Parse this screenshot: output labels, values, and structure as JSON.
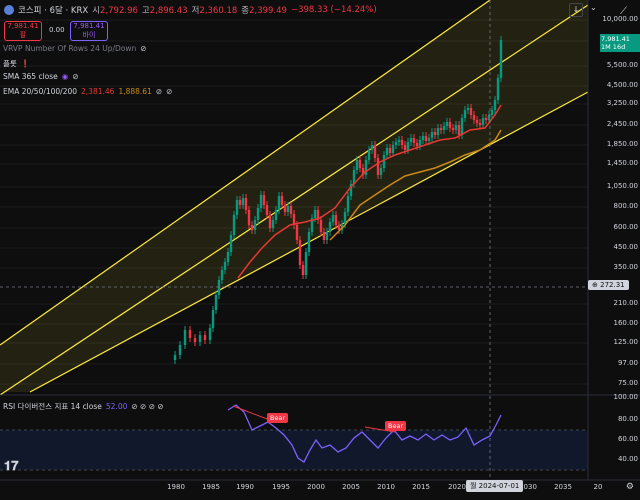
{
  "header": {
    "title": "코스피 · 6달 · KRX",
    "ohlc": [
      {
        "k": "시",
        "v": "2,792.96"
      },
      {
        "k": "고",
        "v": "2,896.43"
      },
      {
        "k": "저",
        "v": "2,360.18"
      },
      {
        "k": "종",
        "v": "2,399.49"
      }
    ],
    "change": "−398.33 (−14.24%)",
    "sell_price": "7,981.41",
    "sell_label": "팔",
    "spread": "0.00",
    "buy_price": "7,981.41",
    "buy_label": "바이"
  },
  "indicators": {
    "vrvp": "VRVP Number Of Rows 24 Up/Down",
    "flag": "플롯",
    "sma": "SMA 365 close",
    "ema_name": "EMA 20/50/100/200",
    "ema_v1": "2,381.46",
    "ema_v2": "1,888.61",
    "rsi": "RSI 다이버전스 지표 14 close",
    "rsi_v": "52.00"
  },
  "price_axis": [
    "10,000.00",
    "8,000.00",
    "5,500.00",
    "4,500.00",
    "3,250.00",
    "2,450.00",
    "1,850.00",
    "1,450.00",
    "1,050.00",
    "800.00",
    "600.00",
    "450.00",
    "350.00",
    "210.00",
    "160.00",
    "125.00",
    "97.00",
    "75.00"
  ],
  "last_price": "7,981.41",
  "last_tf": "1M 16d",
  "crosshair_price": "272.31",
  "rsi_axis": [
    "100.00",
    "80.00",
    "60.00",
    "40.00"
  ],
  "bear_labels": [
    "Bear",
    "Bear"
  ],
  "x_labels": [
    "1980",
    "1985",
    "1990",
    "1995",
    "2000",
    "2005",
    "2010",
    "2015",
    "2020",
    "2030",
    "2035",
    "20"
  ],
  "x_cursor": "월 2024-07-01",
  "colors": {
    "up": "#089981",
    "down": "#f23645",
    "channel": "#ffeb3b",
    "ema1": "#e53935",
    "ema2": "#c98a14",
    "rsi": "#7b61ff"
  }
}
